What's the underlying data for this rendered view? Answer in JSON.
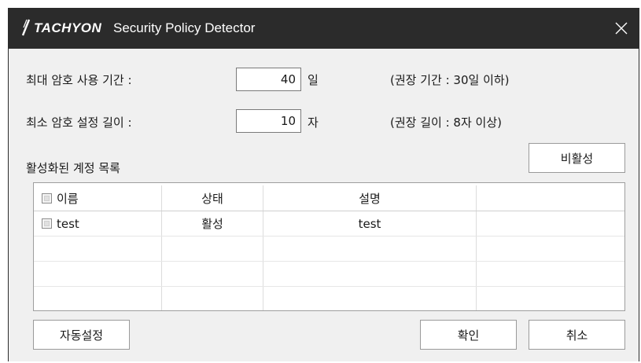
{
  "window": {
    "logo_text": "TACHYON",
    "title": "Security Policy Detector"
  },
  "policy": {
    "max_age_label": "최대 암호 사용 기간 :",
    "max_age_value": "40",
    "max_age_unit": "일",
    "max_age_hint": "(권장 기간 : 30일 이하)",
    "min_len_label": "최소 암호 설정 길이 :",
    "min_len_value": "10",
    "min_len_unit": "자",
    "min_len_hint": "(권장 길이 : 8자 이상)"
  },
  "accounts": {
    "section_label": "활성화된 계정 목록",
    "deactivate_label": "비활성",
    "columns": [
      "이름",
      "상태",
      "설명",
      ""
    ],
    "rows": [
      {
        "name": "test",
        "status": "활성",
        "description": "test",
        "checked": false
      }
    ]
  },
  "footer": {
    "auto_label": "자동설정",
    "ok_label": "확인",
    "cancel_label": "취소"
  },
  "colors": {
    "titlebar": "#2b2b2b",
    "window_bg": "#f0f0f0",
    "grid_border": "#9e9e9e"
  }
}
